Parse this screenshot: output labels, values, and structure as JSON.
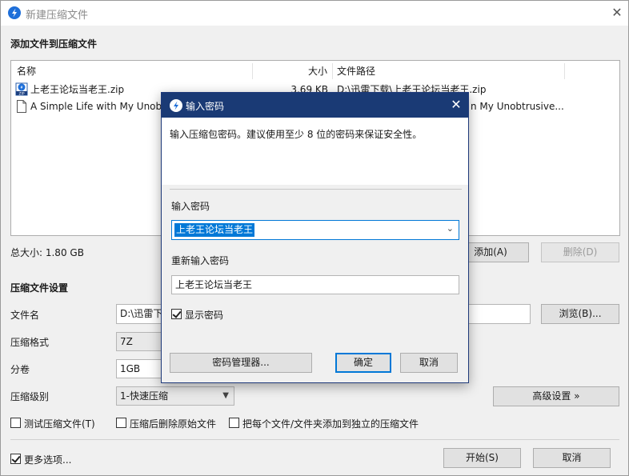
{
  "window": {
    "title": "新建压缩文件",
    "close": "✕"
  },
  "add_section": {
    "title": "添加文件到压缩文件",
    "columns": [
      "名称",
      "大小",
      "文件路径"
    ],
    "files": [
      {
        "name": "上老王论坛当老王.zip",
        "size": "3.69 KB",
        "path": "D:\\迅雷下载\\上老王论坛当老王.zip",
        "icon": "zip-file-icon"
      },
      {
        "name": "A Simple Life with My Unobtrusive Sister...",
        "size": "",
        "path": "n My Unobtrusive...",
        "icon": "document-icon"
      }
    ],
    "total": "总大小: 1.80 GB",
    "add_button": "添加(A)",
    "delete_button": "删除(D)"
  },
  "settings": {
    "title": "压缩文件设置",
    "filename_label": "文件名",
    "filename_value": "D:\\迅雷下",
    "browse_button": "浏览(B)...",
    "format_label": "压缩格式",
    "format_value": "7Z",
    "volume_label": "分卷",
    "volume_value": "1GB",
    "level_label": "压缩级别",
    "level_value": "1-快速压缩",
    "advanced_button": "高级设置 »",
    "test_label": "测试压缩文件(T)",
    "delete_after_label": "压缩后删除原始文件",
    "separate_label": "把每个文件/文件夹添加到独立的压缩文件"
  },
  "footer": {
    "more_options": "更多选项...",
    "start_button": "开始(S)",
    "cancel_button": "取消"
  },
  "dialog": {
    "title": "输入密码",
    "close": "✕",
    "info": "输入压缩包密码。建议使用至少 8 位的密码来保证安全性。",
    "password_label": "输入密码",
    "password_value": "上老王论坛当老王",
    "confirm_label": "重新输入密码",
    "confirm_value": "上老王论坛当老王",
    "show_password": "显示密码",
    "manager_button": "密码管理器...",
    "ok_button": "确定",
    "cancel_button": "取消"
  },
  "colors": {
    "accent": "#0078d7",
    "dialog_title_bg": "#1a3a75"
  }
}
